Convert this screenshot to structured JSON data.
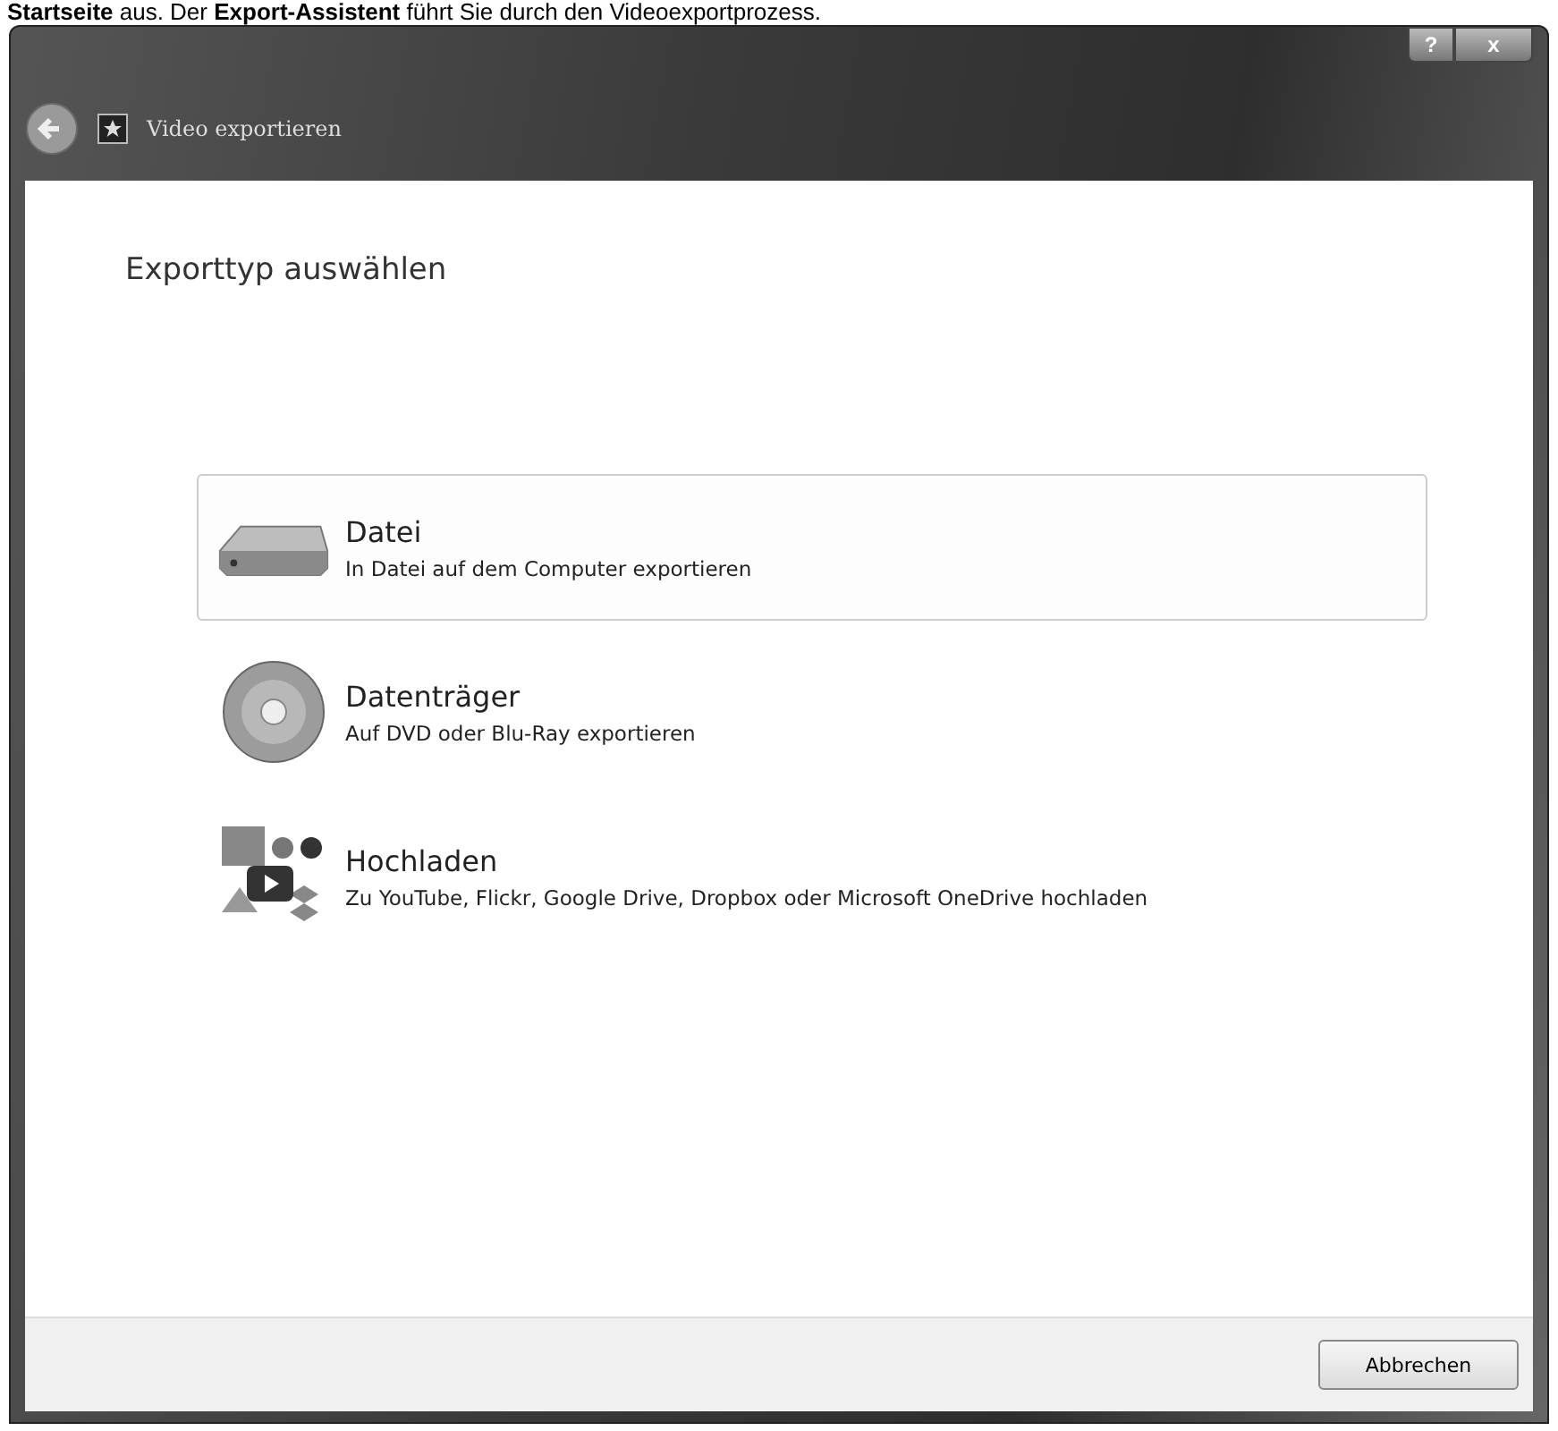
{
  "caption": "**Startseite** aus. Der **Export-Assistent** führt Sie durch den Videoexportprozess.",
  "window": {
    "title": "Video exportieren",
    "help_button": "?",
    "close_button": "x"
  },
  "heading": "Exporttyp auswählen",
  "options": [
    {
      "kind": "file",
      "title": "Datei",
      "description": "In Datei auf dem Computer exportieren",
      "selected": true
    },
    {
      "kind": "disc",
      "title": "Datenträger",
      "description": "Auf DVD oder Blu-Ray exportieren",
      "selected": false
    },
    {
      "kind": "upload",
      "title": "Hochladen",
      "description": "Zu YouTube, Flickr, Google Drive, Dropbox oder Microsoft OneDrive hochladen",
      "selected": false
    }
  ],
  "buttons": [
    "Abbrechen"
  ]
}
